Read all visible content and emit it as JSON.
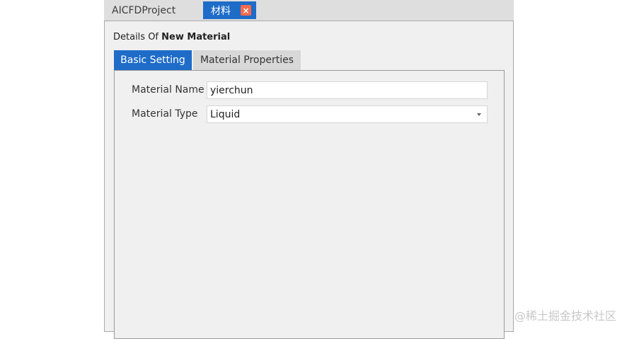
{
  "doc_tabs": {
    "project_label": "AICFDProject",
    "material_label": "材料",
    "close_glyph": "×"
  },
  "details": {
    "prefix": "Details Of ",
    "name": "New Material"
  },
  "tabs": {
    "basic": "Basic Setting",
    "properties": "Material Properties"
  },
  "form": {
    "name_label": "Material Name",
    "name_value": "yierchun",
    "type_label": "Material Type",
    "type_value": "Liquid"
  },
  "watermark": "@稀土掘金技术社区",
  "colors": {
    "accent": "#1e6cc8",
    "close": "#f46a4e"
  }
}
